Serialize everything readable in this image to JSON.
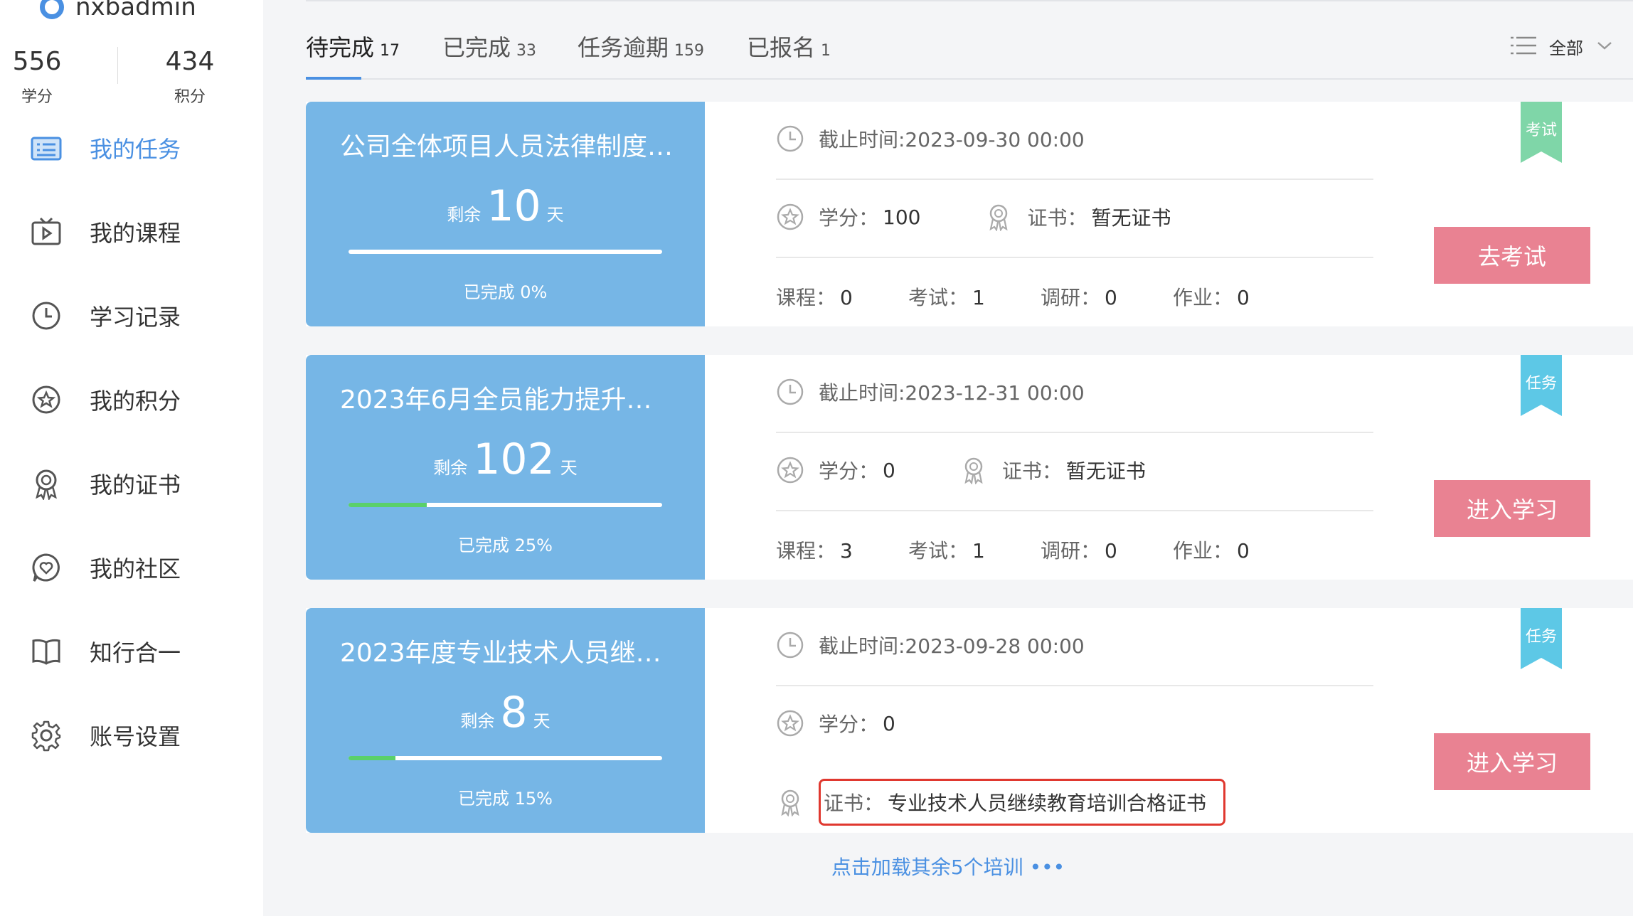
{
  "user": {
    "name": "nxbadmin"
  },
  "stats": [
    {
      "value": "556",
      "label": "学分"
    },
    {
      "value": "434",
      "label": "积分"
    }
  ],
  "nav": [
    {
      "label": "我的任务",
      "icon": "task-list-icon",
      "active": true
    },
    {
      "label": "我的课程",
      "icon": "video-icon",
      "active": false
    },
    {
      "label": "学习记录",
      "icon": "clock-icon",
      "active": false
    },
    {
      "label": "我的积分",
      "icon": "star-icon",
      "active": false
    },
    {
      "label": "我的证书",
      "icon": "certificate-icon",
      "active": false
    },
    {
      "label": "我的社区",
      "icon": "community-icon",
      "active": false
    },
    {
      "label": "知行合一",
      "icon": "book-icon",
      "active": false
    },
    {
      "label": "账号设置",
      "icon": "gear-icon",
      "active": false
    }
  ],
  "tabs": [
    {
      "label": "待完成",
      "count": "17",
      "active": true
    },
    {
      "label": "已完成",
      "count": "33",
      "active": false
    },
    {
      "label": "任务逾期",
      "count": "159",
      "active": false
    },
    {
      "label": "已报名",
      "count": "1",
      "active": false
    }
  ],
  "filter": {
    "label": "全部"
  },
  "labels": {
    "remain_prefix": "剩余",
    "remain_suffix": "天",
    "credit": "学分：",
    "cert": "证书：",
    "course": "课程：",
    "exam": "考试：",
    "survey": "调研：",
    "homework": "作业："
  },
  "cards": [
    {
      "title": "公司全体项目人员法律制度…",
      "days": "10",
      "progress_text": "已完成 0%",
      "progress": 0,
      "deadline": "截止时间:2023-09-30 00:00",
      "credit": "100",
      "cert": "暂无证书",
      "course": "0",
      "exam": "1",
      "survey": "0",
      "homework": "0",
      "tag": "考试",
      "tag_color": "#7fd6a8",
      "action": "去考试"
    },
    {
      "title": "2023年6月全员能力提升…",
      "days": "102",
      "progress_text": "已完成 25%",
      "progress": 25,
      "deadline": "截止时间:2023-12-31 00:00",
      "credit": "0",
      "cert": "暂无证书",
      "course": "3",
      "exam": "1",
      "survey": "0",
      "homework": "0",
      "tag": "任务",
      "tag_color": "#5dc8e6",
      "action": "进入学习"
    },
    {
      "title": "2023年度专业技术人员继…",
      "days": "8",
      "progress_text": "已完成 15%",
      "progress": 15,
      "deadline": "截止时间:2023-09-28 00:00",
      "credit": "0",
      "cert": "专业技术人员继续教育培训合格证书",
      "tag": "任务",
      "tag_color": "#5dc8e6",
      "action": "进入学习"
    }
  ],
  "load_more": "点击加载其余5个培训 •••"
}
